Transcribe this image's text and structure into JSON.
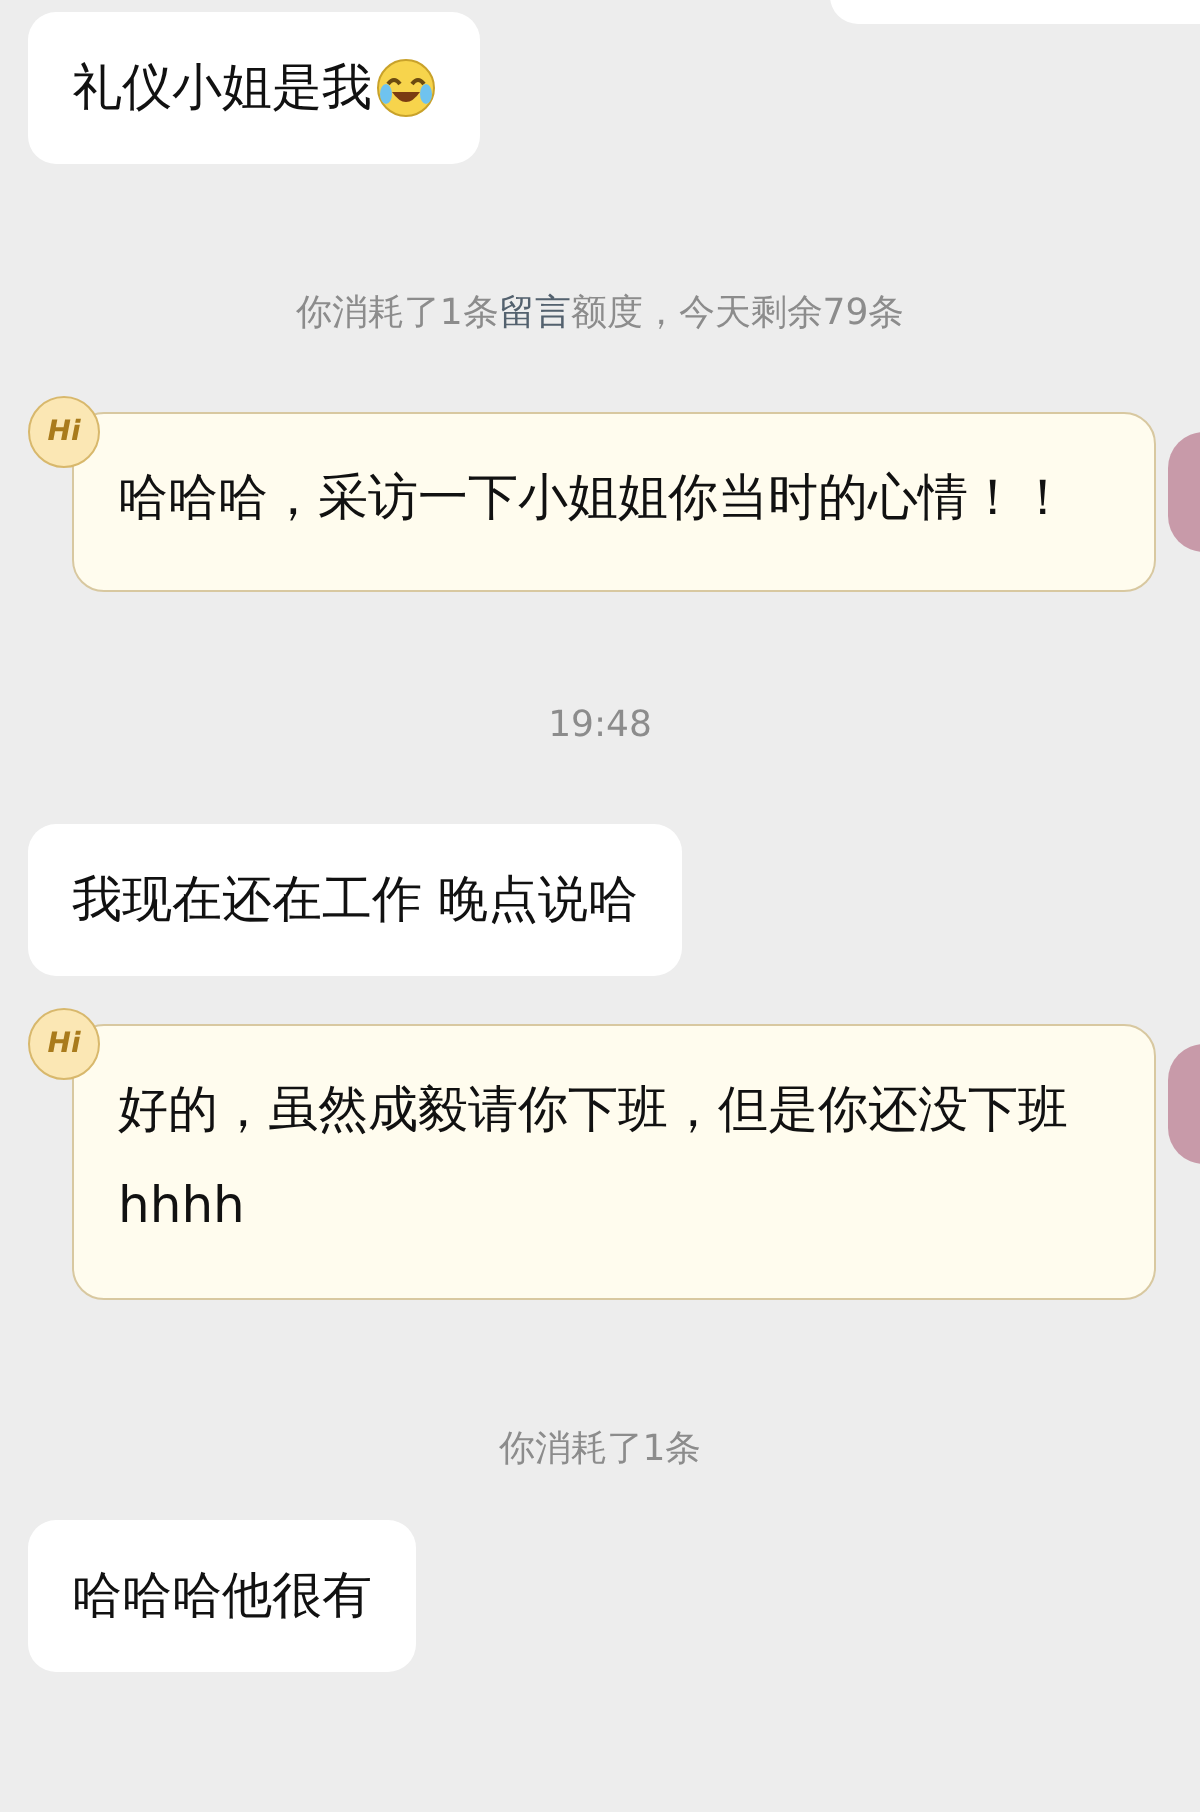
{
  "messages": [
    {
      "kind": "edge"
    },
    {
      "kind": "incoming",
      "text": "礼仪小姐是我",
      "emoji": true
    },
    {
      "kind": "notice",
      "parts": [
        {
          "text": "你消耗了1条",
          "highlight": false
        },
        {
          "text": "留言",
          "highlight": true
        },
        {
          "text": "额度，今天剩余79条",
          "highlight": false
        }
      ]
    },
    {
      "kind": "greeting",
      "badge": "Hi",
      "text": "哈哈哈，采访一下小姐姐你当时的心情！！"
    },
    {
      "kind": "time",
      "text": "19:48"
    },
    {
      "kind": "incoming",
      "text": "我现在还在工作 晚点说哈",
      "emoji": false
    },
    {
      "kind": "greeting",
      "badge": "Hi",
      "text": "好的，虽然成毅请你下班，但是你还没下班hhhh"
    },
    {
      "kind": "notice",
      "parts": [
        {
          "text": "你消耗了1条",
          "highlight": false
        }
      ]
    },
    {
      "kind": "incoming",
      "text": "哈哈哈他很有",
      "emoji": false
    }
  ]
}
